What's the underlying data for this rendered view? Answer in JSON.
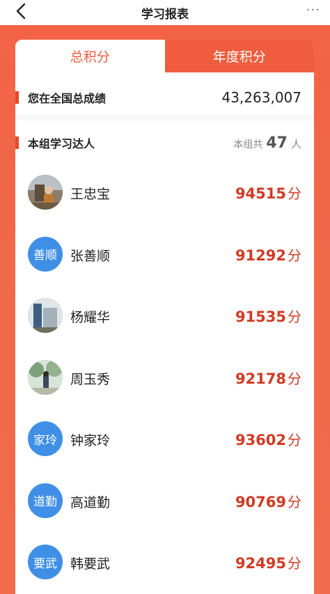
{
  "nav": {
    "title": "学习报表",
    "back_icon": "chevron-left-icon",
    "more_label": "···"
  },
  "tabs": [
    {
      "label": "总积分",
      "active": true
    },
    {
      "label": "年度积分",
      "active": false
    }
  ],
  "national": {
    "label": "您在全国总成绩",
    "value": "43,263,007"
  },
  "group": {
    "label": "本组学习达人",
    "count_prefix": "本组共",
    "count": "47",
    "count_suffix": "人"
  },
  "members": [
    {
      "name": "王忠宝",
      "score": "94515",
      "unit": "分",
      "avatar_text": "",
      "avatar_type": "photo"
    },
    {
      "name": "张善顺",
      "score": "91292",
      "unit": "分",
      "avatar_text": "善顺",
      "avatar_type": "text"
    },
    {
      "name": "杨耀华",
      "score": "91535",
      "unit": "分",
      "avatar_text": "",
      "avatar_type": "photo"
    },
    {
      "name": "周玉秀",
      "score": "92178",
      "unit": "分",
      "avatar_text": "",
      "avatar_type": "photo"
    },
    {
      "name": "钟家玲",
      "score": "93602",
      "unit": "分",
      "avatar_text": "家玲",
      "avatar_type": "text"
    },
    {
      "name": "高道勤",
      "score": "90769",
      "unit": "分",
      "avatar_text": "道勤",
      "avatar_type": "text"
    },
    {
      "name": "韩要武",
      "score": "92495",
      "unit": "分",
      "avatar_text": "要武",
      "avatar_type": "text"
    }
  ],
  "colors": {
    "accent": "#ef5d3e",
    "score": "#d03b24",
    "avatar_blue": "#3f8fe6"
  }
}
